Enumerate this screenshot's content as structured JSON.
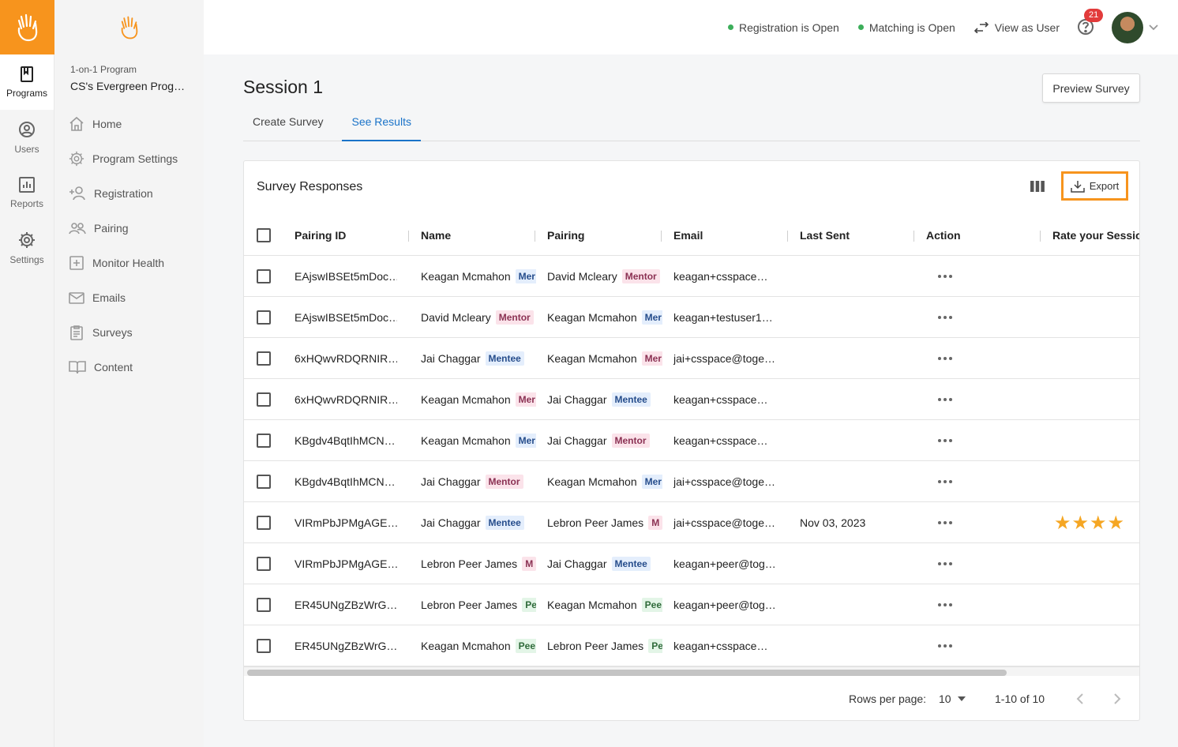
{
  "rail": {
    "items": [
      {
        "label": "Programs",
        "icon": "book-icon"
      },
      {
        "label": "Users",
        "icon": "user-circle-icon"
      },
      {
        "label": "Reports",
        "icon": "bar-chart-icon"
      },
      {
        "label": "Settings",
        "icon": "gear-icon"
      }
    ]
  },
  "sidebar": {
    "program_type": "1-on-1 Program",
    "program_name": "CS's Evergreen Prog…",
    "items": [
      {
        "label": "Home"
      },
      {
        "label": "Program Settings"
      },
      {
        "label": "Registration"
      },
      {
        "label": "Pairing"
      },
      {
        "label": "Monitor Health"
      },
      {
        "label": "Emails"
      },
      {
        "label": "Surveys"
      },
      {
        "label": "Content"
      }
    ]
  },
  "topbar": {
    "registration_status": "Registration is Open",
    "matching_status": "Matching is Open",
    "view_as_user": "View as User",
    "notifications_count": "21",
    "status_color": "#3cae5a"
  },
  "page": {
    "title": "Session 1",
    "preview_button": "Preview Survey",
    "tabs": [
      {
        "label": "Create Survey"
      },
      {
        "label": "See Results"
      }
    ]
  },
  "card": {
    "title": "Survey Responses",
    "export_label": "Export",
    "columns": [
      "Pairing ID",
      "Name",
      "Pairing",
      "Email",
      "Last Sent",
      "Action",
      "Rate your Session"
    ],
    "rows": [
      {
        "pairing_id": "EAjswIBSEt5mDoc…",
        "name": "Keagan Mcmahon",
        "name_tag": "Mer",
        "name_tag_type": "mentee",
        "pairing": "David Mcleary",
        "pairing_tag": "Mentor",
        "pairing_tag_type": "mentor",
        "email": "keagan+csspace…",
        "last_sent": "",
        "rating": ""
      },
      {
        "pairing_id": "EAjswIBSEt5mDoc…",
        "name": "David Mcleary",
        "name_tag": "Mentor",
        "name_tag_type": "mentor",
        "pairing": "Keagan Mcmahon",
        "pairing_tag": "Mer",
        "pairing_tag_type": "mentee",
        "email": "keagan+testuser1…",
        "last_sent": "",
        "rating": ""
      },
      {
        "pairing_id": "6xHQwvRDQRNIR…",
        "name": "Jai Chaggar",
        "name_tag": "Mentee",
        "name_tag_type": "mentee",
        "pairing": "Keagan Mcmahon",
        "pairing_tag": "Mer",
        "pairing_tag_type": "mentor",
        "email": "jai+csspace@toge…",
        "last_sent": "",
        "rating": ""
      },
      {
        "pairing_id": "6xHQwvRDQRNIR…",
        "name": "Keagan Mcmahon",
        "name_tag": "Mer",
        "name_tag_type": "mentor",
        "pairing": "Jai Chaggar",
        "pairing_tag": "Mentee",
        "pairing_tag_type": "mentee",
        "email": "keagan+csspace…",
        "last_sent": "",
        "rating": ""
      },
      {
        "pairing_id": "KBgdv4BqtIhMCN…",
        "name": "Keagan Mcmahon",
        "name_tag": "Mer",
        "name_tag_type": "mentee",
        "pairing": "Jai Chaggar",
        "pairing_tag": "Mentor",
        "pairing_tag_type": "mentor",
        "email": "keagan+csspace…",
        "last_sent": "",
        "rating": ""
      },
      {
        "pairing_id": "KBgdv4BqtIhMCN…",
        "name": "Jai Chaggar",
        "name_tag": "Mentor",
        "name_tag_type": "mentor",
        "pairing": "Keagan Mcmahon",
        "pairing_tag": "Mer",
        "pairing_tag_type": "mentee",
        "email": "jai+csspace@toge…",
        "last_sent": "",
        "rating": ""
      },
      {
        "pairing_id": "VIRmPbJPMgAGE…",
        "name": "Jai Chaggar",
        "name_tag": "Mentee",
        "name_tag_type": "mentee",
        "pairing": "Lebron Peer James",
        "pairing_tag": "M",
        "pairing_tag_type": "mentor",
        "email": "jai+csspace@toge…",
        "last_sent": "Nov 03, 2023",
        "rating": "★★★★"
      },
      {
        "pairing_id": "VIRmPbJPMgAGE…",
        "name": "Lebron Peer James",
        "name_tag": "M",
        "name_tag_type": "mentor",
        "pairing": "Jai Chaggar",
        "pairing_tag": "Mentee",
        "pairing_tag_type": "mentee",
        "email": "keagan+peer@tog…",
        "last_sent": "",
        "rating": ""
      },
      {
        "pairing_id": "ER45UNgZBzWrG…",
        "name": "Lebron Peer James",
        "name_tag": "Pe",
        "name_tag_type": "peer",
        "pairing": "Keagan Mcmahon",
        "pairing_tag": "Pee",
        "pairing_tag_type": "peer",
        "email": "keagan+peer@tog…",
        "last_sent": "",
        "rating": ""
      },
      {
        "pairing_id": "ER45UNgZBzWrG…",
        "name": "Keagan Mcmahon",
        "name_tag": "Pee",
        "name_tag_type": "peer",
        "pairing": "Lebron Peer James",
        "pairing_tag": "Pe",
        "pairing_tag_type": "peer",
        "email": "keagan+csspace…",
        "last_sent": "",
        "rating": ""
      }
    ]
  },
  "pagination": {
    "rows_per_page_label": "Rows per page:",
    "rows_per_page_value": "10",
    "range": "1-10 of 10"
  },
  "colors": {
    "brand": "#f7941d",
    "accent": "#1a73c8",
    "star": "#f5a623"
  }
}
